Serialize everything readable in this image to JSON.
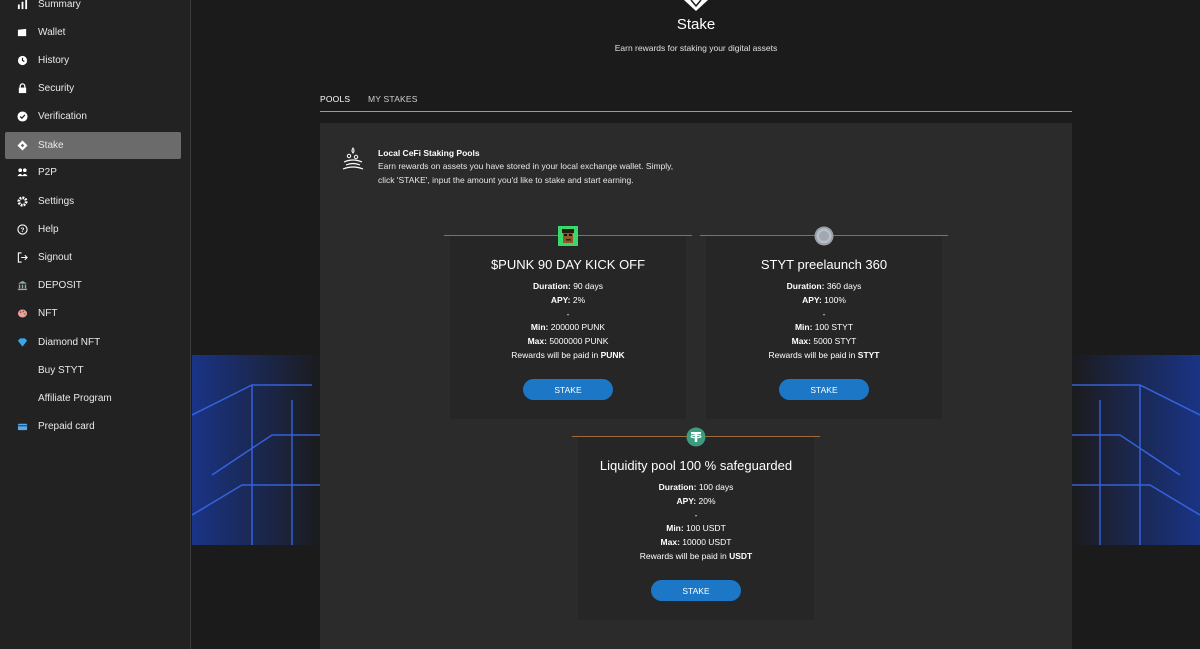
{
  "sidebar": {
    "items": [
      {
        "label": "Summary",
        "icon": "bar-chart-icon"
      },
      {
        "label": "Wallet",
        "icon": "wallet-icon"
      },
      {
        "label": "History",
        "icon": "clock-icon"
      },
      {
        "label": "Security",
        "icon": "lock-icon"
      },
      {
        "label": "Verification",
        "icon": "check-circle-icon"
      },
      {
        "label": "Stake",
        "icon": "stake-icon",
        "active": true
      },
      {
        "label": "P2P",
        "icon": "users-icon"
      },
      {
        "label": "Settings",
        "icon": "gear-icon"
      },
      {
        "label": "Help",
        "icon": "help-icon"
      },
      {
        "label": "Signout",
        "icon": "signout-icon"
      },
      {
        "label": "DEPOSIT",
        "icon": "bank-icon"
      },
      {
        "label": "NFT",
        "icon": "palette-icon"
      },
      {
        "label": "Diamond NFT",
        "icon": "diamond-icon"
      },
      {
        "label": "Buy STYT",
        "icon": ""
      },
      {
        "label": "Affiliate Program",
        "icon": ""
      },
      {
        "label": "Prepaid card",
        "icon": "card-icon"
      }
    ]
  },
  "header": {
    "title": "Stake",
    "subtitle": "Earn rewards for staking your digital assets"
  },
  "tabs": [
    {
      "label": "POOLS",
      "active": true
    },
    {
      "label": "MY STAKES",
      "active": false
    }
  ],
  "intro": {
    "title": "Local CeFi Staking Pools",
    "text": "Earn rewards on assets you have stored in your local exchange wallet. Simply, click 'STAKE', input the amount you'd like to stake and start earning."
  },
  "labels": {
    "duration": "Duration:",
    "apy": "APY:",
    "separator": "-",
    "min": "Min:",
    "max": "Max:",
    "rewards_prefix": "Rewards will be paid in"
  },
  "pools": [
    {
      "name": "$PUNK 90 DAY KICK OFF",
      "duration": "90 days",
      "apy": "2%",
      "min": "200000 PUNK",
      "max": "5000000 PUNK",
      "reward_asset": "PUNK",
      "button": "STAKE",
      "coin": "punk-coin-icon"
    },
    {
      "name": "STYT preelaunch 360",
      "duration": "360 days",
      "apy": "100%",
      "min": "100 STYT",
      "max": "5000 STYT",
      "reward_asset": "STYT",
      "button": "STAKE",
      "coin": "styt-coin-icon"
    },
    {
      "name": "Liquidity pool 100 % safeguarded",
      "duration": "100 days",
      "apy": "20%",
      "min": "100 USDT",
      "max": "10000 USDT",
      "reward_asset": "USDT",
      "button": "STAKE",
      "coin": "tether-coin-icon"
    }
  ],
  "colors": {
    "accent_button": "#1c78c6",
    "active_nav": "#6b6b6b",
    "pool_divider": "#9b6a3a",
    "tether": "#3f9b7e"
  }
}
